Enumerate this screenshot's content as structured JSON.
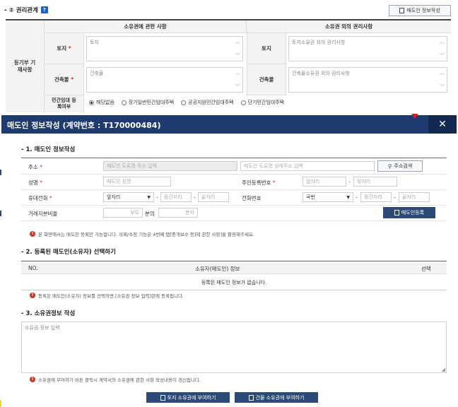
{
  "rights": {
    "title": "- ② 권리관계",
    "help": "?",
    "seller_btn": "매도인 정보작성",
    "header_ownership": "소유권에 관한 사항",
    "header_other": "소유권 외의 권리사항",
    "row_group_label": "등기부 기재사항",
    "land_label": "토지",
    "building_label": "건축물",
    "land_value": "토지",
    "building_value": "건축물",
    "other_land_label": "토지",
    "other_building_label": "건축물",
    "other_land_value": "토지소유권 외의 권리사항",
    "other_building_value": "건축물소유권 외의 권리사항",
    "rental_label": "민간임대 등록여부",
    "rental_options": [
      "해당없음",
      "장기일반민간임대주택",
      "공공지원민간임대주택",
      "단기민간임대주택"
    ]
  },
  "modal": {
    "title": "매도인 정보작성 (계약번호 : T170000484)",
    "close": "✕",
    "accent": "#1e3a6e"
  },
  "section1": {
    "title": "- 1. 매도인 정보작성",
    "address_label": "주소",
    "address_ph": "매도인 도로명 주소 입력",
    "address_detail_ph": "매도인 도로명 상세주소 입력",
    "address_search": "주소검색",
    "name_label": "성명",
    "name_ph": "매도인 성명",
    "rrn_label": "주민등록번호",
    "rrn_front_ph": "앞자리",
    "rrn_back_ph": "뒷자리",
    "mobile_label": "휴대전화",
    "mobile_prefix": "앞자리",
    "mobile_mid_ph": "중간자리",
    "mobile_end_ph": "끝자리",
    "phone_label": "전화번호",
    "phone_prefix": "국번",
    "phone_mid_ph": "중간자리",
    "phone_end_ph": "끝자리",
    "share_label": "거래지분비율",
    "share_num_ph": "부모",
    "share_mid": "분의",
    "share_den_ph": "분자",
    "register_btn": "매도인등록",
    "note": "본 화면에서는 매도인 등록만 가능합니다. 삭제/수정 기능은 4번째 탭[중개보수 등]에 관한 사항]을 활용해주세요."
  },
  "section2": {
    "title": "- 2. 등록된 매도인(소유자) 선택하기",
    "col_no": "NO.",
    "col_info": "소유자(매도인) 정보",
    "col_select": "선택",
    "empty": "등록된 매도인 정보가 없습니다.",
    "note": "등록된 매도인(소유자) 정보를 선택하면 [소유권 정보 입력]란에 등록됩니다."
  },
  "section3": {
    "title": "- 3. 소유권정보 작성",
    "textarea_ph": "소유권 정보 입력",
    "note": "소유권에 부여하기 버튼 클릭시 계약서의 소유권에 관한 사항 작성내용이 갱신됩니다.",
    "land_btn": "토지 소유권에 부여하기",
    "building_btn": "건물 소유권에 부여하기"
  }
}
